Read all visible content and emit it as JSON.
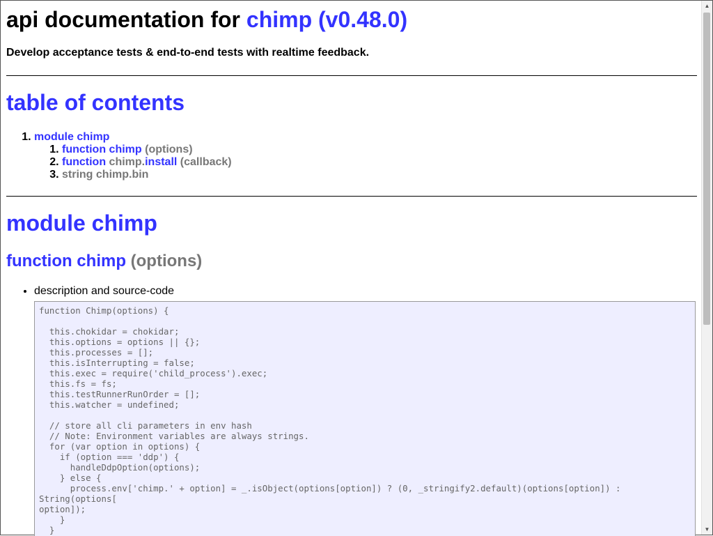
{
  "header": {
    "title_prefix": "api documentation for",
    "title_link": "chimp (v0.48.0)",
    "tagline": "Develop acceptance tests & end-to-end tests with realtime feedback."
  },
  "toc": {
    "heading": "table of contents",
    "modules": [
      {
        "label": "module chimp",
        "items": [
          {
            "kind": "function",
            "name": "chimp",
            "args": "(options)"
          },
          {
            "kind": "function",
            "prefix": "chimp.",
            "name": "install",
            "args": "(callback)"
          },
          {
            "label": "string chimp.bin"
          }
        ]
      }
    ]
  },
  "module_section": {
    "heading": "module chimp",
    "function_heading": {
      "link": "function chimp",
      "args": "(options)"
    },
    "bullet": "description and source-code",
    "code": "function Chimp(options) {\n\n  this.chokidar = chokidar;\n  this.options = options || {};\n  this.processes = [];\n  this.isInterrupting = false;\n  this.exec = require('child_process').exec;\n  this.fs = fs;\n  this.testRunnerRunOrder = [];\n  this.watcher = undefined;\n\n  // store all cli parameters in env hash\n  // Note: Environment variables are always strings.\n  for (var option in options) {\n    if (option === 'ddp') {\n      handleDdpOption(options);\n    } else {\n      process.env['chimp.' + option] = _.isObject(options[option]) ? (0, _stringify2.default)(options[option]) :\nString(options[\noption]);\n    }\n  }"
  }
}
